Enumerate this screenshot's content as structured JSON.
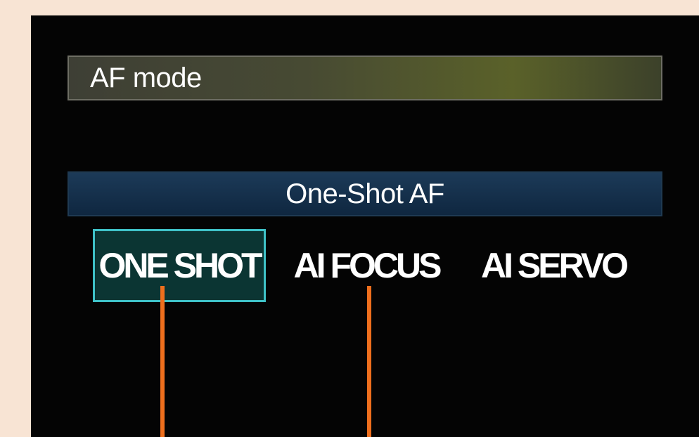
{
  "menu": {
    "title": "AF mode",
    "current_value": "One-Shot AF",
    "options": [
      {
        "label": "ONE SHOT",
        "selected": true
      },
      {
        "label": "AI FOCUS",
        "selected": false
      },
      {
        "label": "AI SERVO",
        "selected": false
      }
    ]
  },
  "colors": {
    "selection_border": "#3fc2c8",
    "callout_line": "#ef6f1d",
    "screen_background": "#040404",
    "page_background": "#f8e4d4"
  }
}
